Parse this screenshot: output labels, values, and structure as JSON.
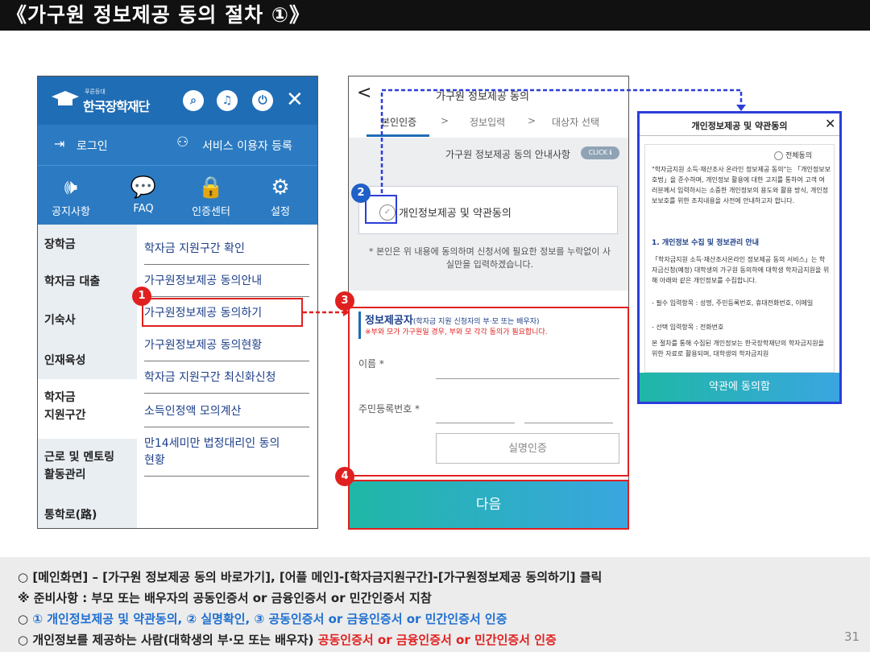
{
  "slide": {
    "title": "《가구원 정보제공 동의 절차 ①》",
    "page_number": "31"
  },
  "left_app": {
    "logo_small": "푸른등대",
    "logo": "한국장학재단",
    "header_icons": [
      "search-icon",
      "bell-icon",
      "power-icon",
      "close-icon"
    ],
    "login": "로그인",
    "register": "서비스 이용자 등록",
    "quick": [
      {
        "label": "공지사항",
        "icon": "megaphone-icon"
      },
      {
        "label": "FAQ",
        "icon": "chat-icon"
      },
      {
        "label": "인증센터",
        "icon": "lock-icon"
      },
      {
        "label": "설정",
        "icon": "gear-icon"
      }
    ],
    "categories": [
      "장학금",
      "학자금 대출",
      "기숙사",
      "인재육성",
      "학자금\n지원구간",
      "근로 및 멘토링\n활동관리",
      "통학로(路)"
    ],
    "submenu": [
      "학자금 지원구간 확인",
      "가구원정보제공 동의안내",
      "가구원정보제공 동의하기",
      "가구원정보제공 동의현황",
      "학자금 지원구간 최신화신청",
      "소득인정액 모의계산",
      "만14세미만 법정대리인 동의\n현황"
    ]
  },
  "consent_screen": {
    "back": "<",
    "title": "가구원 정보제공 동의",
    "steps": [
      "본인인증",
      "정보입력",
      "대상자 선택"
    ],
    "sep": ">",
    "guide": "가구원 정보제공 동의 안내사항",
    "click_badge": "CLICK ℹ",
    "agree_label": "개인정보제공 및 약관동의",
    "check": "✓",
    "note": "* 본인은 위 내용에 동의하며 신청서에 필요한 정보를 누락없이 사실만을 입력하겠습니다.",
    "provider_title": "정보제공자",
    "provider_sub": "(학자금 지원 신청자의 부·모 또는 배우자)",
    "provider_warn": "※부와 모가 가구원일 경우, 부와 모 각각 동의가 필요합니다.",
    "name_label": "이름 *",
    "rrn_label": "주민등록번호 *",
    "verify_button": "실명인증",
    "next_button": "다음"
  },
  "terms_popup": {
    "title": "개인정보제공 및 약관동의",
    "close": "✕",
    "agree_all": "전체동의",
    "p1": "\"학자금지원 소득·재산조사 온라인 정보제공 동의\"는 「개인정보보호법」을 준수하며, 개인정보 활용에 대한 고지를 통하여 고객 여러분께서 입력하시는 소중한 개인정보의 용도와 활용 방식, 개인정보보호를 위한 조치내용을 사전에 안내하고자 합니다.",
    "h1": "1. 개인정보 수집 및 정보관리 안내",
    "p2": "「학자금지원 소득·재산조사온라인 정보제공 동의 서비스」는 학자금신청(예정) 대학생의 가구원 동의하에 대학생 학자금지원을 위해 아래와 같은 개인정보를 수집합니다.",
    "li1": "- 필수 입력항목 : 성명, 주민등록번호, 휴대전화번호, 이메일",
    "li2": "- 선택 입력항목 : 전화번호",
    "p3": "본 절차를 통해 수집된 개인정보는 한국장학재단의 학자금지원을 위한 자료로 활용되며, 대학생의 학자금지원",
    "button": "약관에 동의함"
  },
  "annotations": {
    "n1": "1",
    "n2": "2",
    "n3": "3",
    "n4": "4"
  },
  "bottom": {
    "bullet": "○",
    "l1": "[메인화면] – [가구원 정보제공 동의 바로가기], [어플 메인]-[학자금지원구간]-[가구원정보제공 동의하기] 클릭",
    "l2": "※ 준비사항 : 부모 또는 배우자의 공동인증서 or 금융인증서 or 민간인증서 지참",
    "l3": "① 개인정보제공 및 약관동의, ② 실명확인, ③ 공동인증서 or 금융인증서 or 민간인증서 인증",
    "l4a": "개인정보를 제공하는 사람(대학생의 부·모 또는 배우자) ",
    "l4b": "공동인증서 or 금융인증서 or 민간인증서 인증"
  }
}
